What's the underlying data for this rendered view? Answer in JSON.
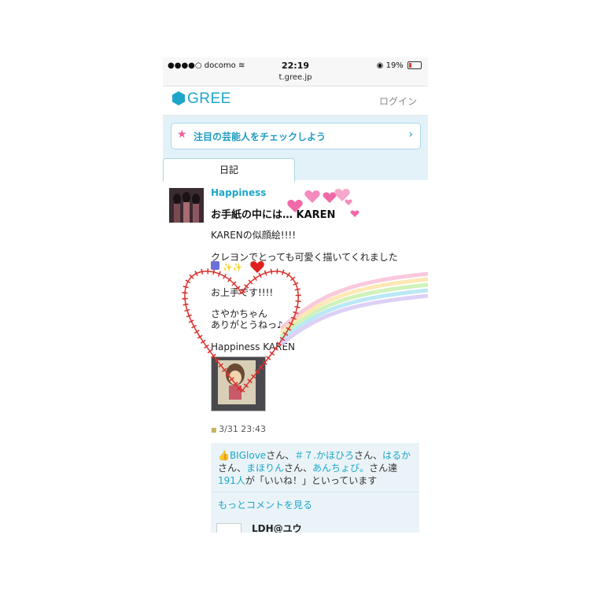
{
  "status_bar": {
    "carrier": "●●●●○ docomo",
    "wifi_icon": "wifi-icon",
    "time": "22:19",
    "battery": "19%",
    "url": "t.gree.jp"
  },
  "header": {
    "logo": "GREE",
    "login": "ログイン"
  },
  "banner": {
    "text": "注目の芸能人をチェックしよう",
    "star": "★",
    "chevron": "›"
  },
  "tabs": {
    "diary": "日記"
  },
  "post": {
    "author": "Happiness",
    "title": "お手紙の中には…  KAREN",
    "lines": [
      "KARENの似顔絵!!!!",
      "クレヨンでとっても可愛く描いてくれました",
      "お上手です!!!!",
      "さやかちゃん",
      "ありがとうねっ♪",
      "Happiness KAREN"
    ],
    "date": "3/31 23:43"
  },
  "likes": {
    "thumb": "👍",
    "u1": "BIGlove",
    "t1": "さん、",
    "u2": "＃７.かほひろ",
    "t2": "さん、",
    "u3": "はるか",
    "t3": "さん、",
    "u4": "まほりん",
    "t4": "さん、",
    "u5": "あんちょび。",
    "t5": "さん達",
    "count": "191人",
    "t6": "が「いいね！」といっています",
    "more": "もっとコメントを見る",
    "commenter": "LDH@ユウ"
  },
  "colors": {
    "accent": "#1ea6c9",
    "pink": "#ef5b9c",
    "heart_red": "#d9302c"
  }
}
